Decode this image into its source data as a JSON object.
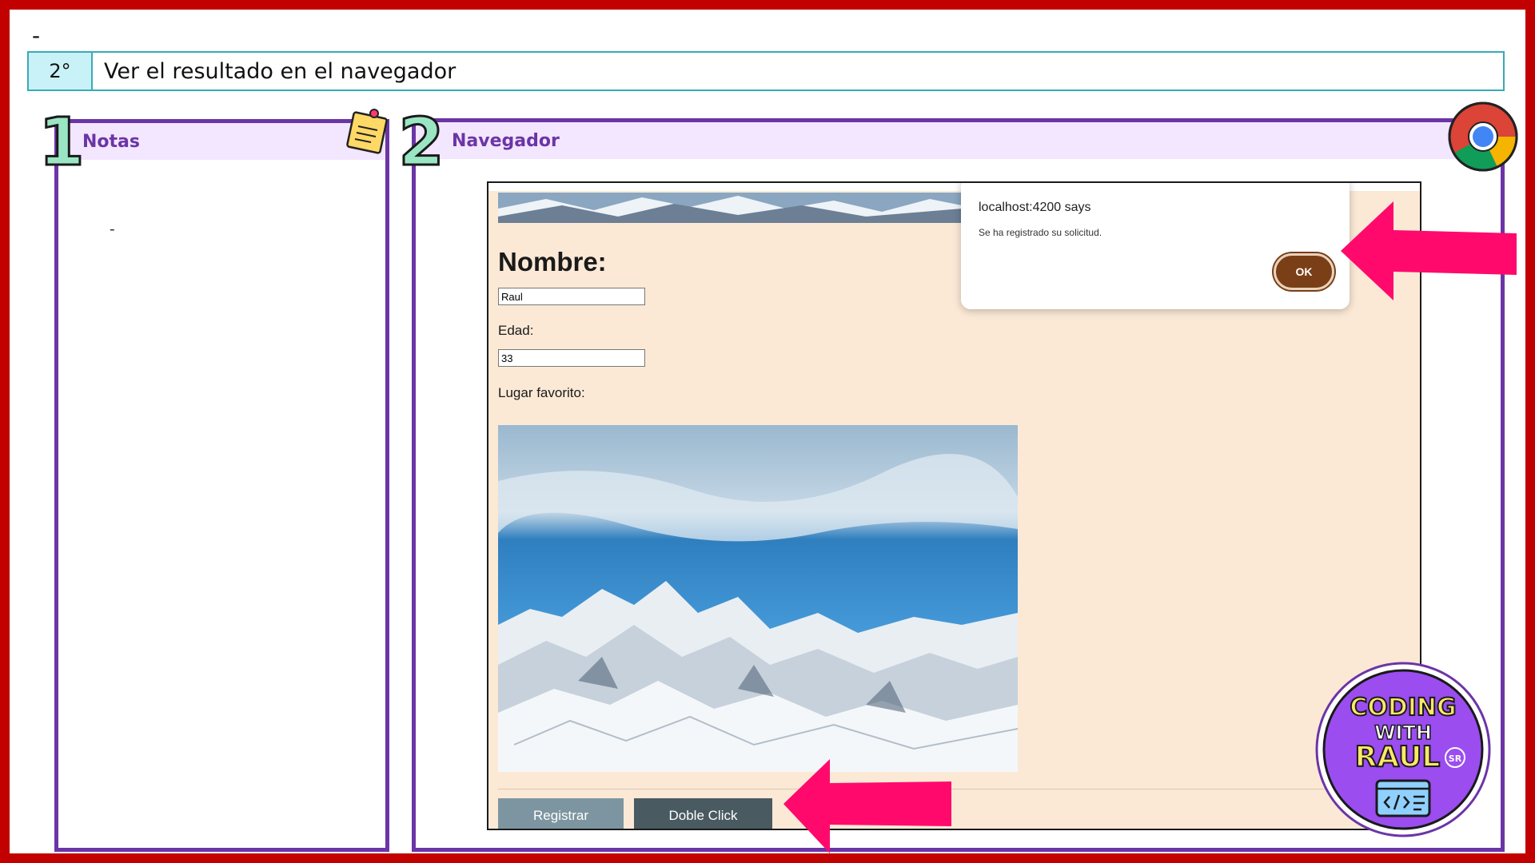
{
  "header": {
    "dash": "-"
  },
  "step": {
    "number": "2°",
    "text": "Ver el resultado en el navegador"
  },
  "notes": {
    "badge": "1",
    "title": "Notas",
    "content": "-",
    "icon": "sticky-note-icon"
  },
  "browser": {
    "badge": "2",
    "title": "Navegador",
    "icon": "chrome-icon"
  },
  "form": {
    "title": "Nombre:",
    "name_value": "Raul",
    "age_label": "Edad:",
    "age_value": "33",
    "place_label": "Lugar favorito:",
    "register_label": "Registrar",
    "double_click_label": "Doble Click"
  },
  "alert": {
    "title": "localhost:4200 says",
    "message": "Se ha registrado su solicitud.",
    "ok_label": "OK"
  },
  "logo": {
    "line1": "CODING",
    "line2": "WITH",
    "line3": "RAUL",
    "badge": "SR"
  },
  "colors": {
    "frame": "#c20000",
    "panel_border": "#6b35a6",
    "panel_header": "#f3e6ff",
    "step_border": "#3aaab8",
    "arrow": "#ff0a6c",
    "ok_button": "#7a3f16"
  }
}
